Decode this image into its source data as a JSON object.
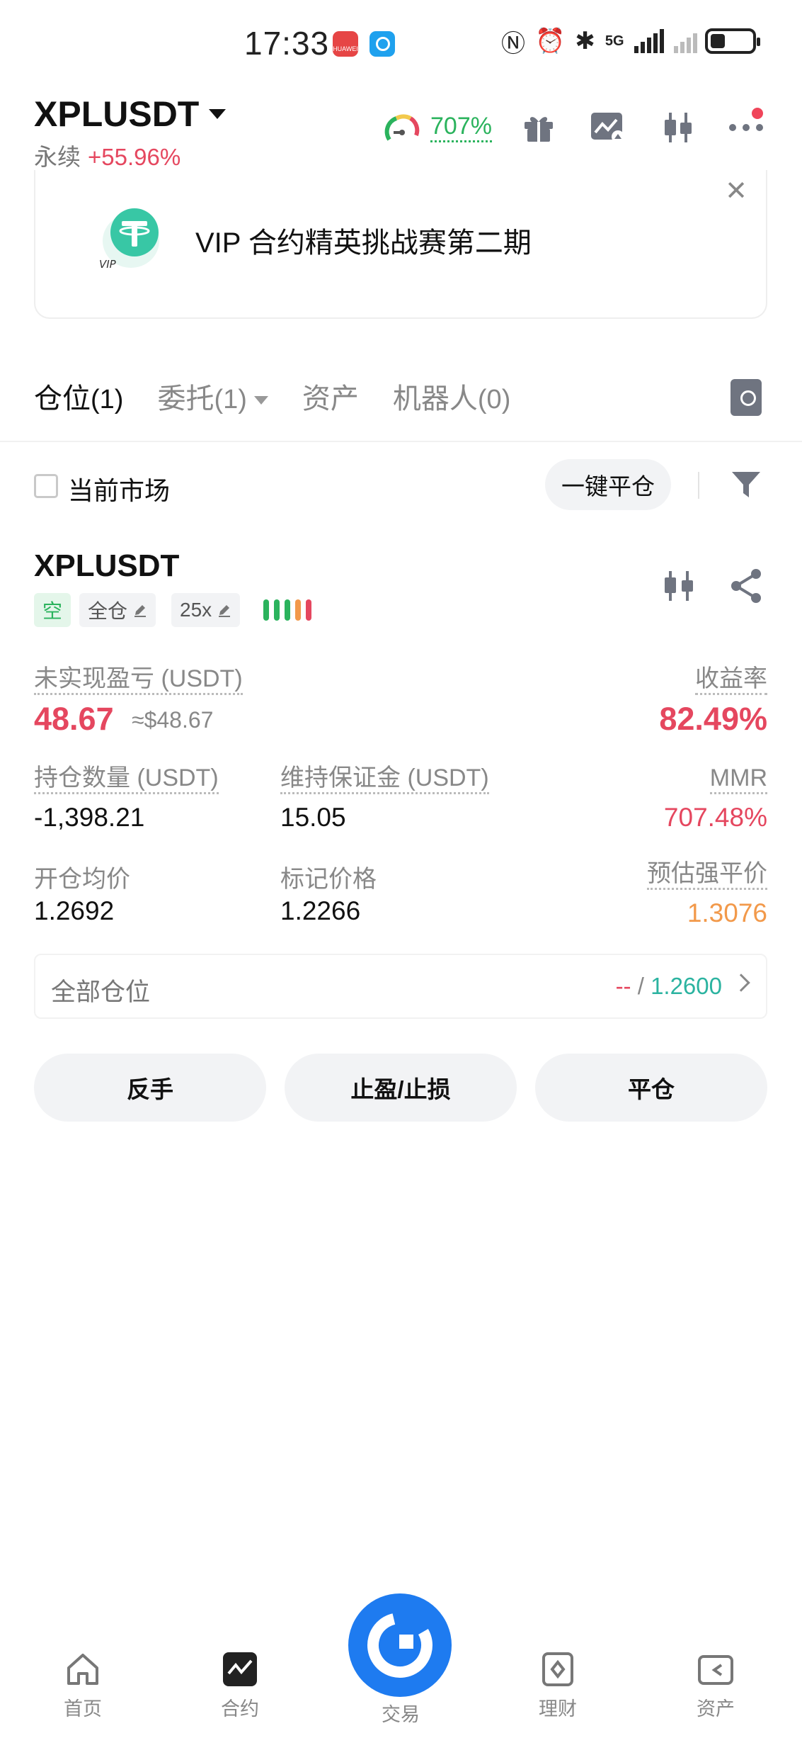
{
  "status_bar": {
    "time": "17:33",
    "app1_label": "HUAWEI",
    "network": "5G"
  },
  "header": {
    "symbol": "XPLUSDT",
    "contract_type": "永续",
    "change": "+55.96%",
    "risk_value": "707%"
  },
  "banner": {
    "text": "VIP 合约精英挑战赛第二期",
    "logo_text": "VIP"
  },
  "tabs": [
    {
      "label": "仓位",
      "count": "(1)",
      "active": true
    },
    {
      "label": "委托",
      "count": "(1)",
      "active": false
    },
    {
      "label": "资产",
      "count": "",
      "active": false
    },
    {
      "label": "机器人",
      "count": "(0)",
      "active": false
    }
  ],
  "filter": {
    "current_market_label": "当前市场",
    "current_market_checked": false,
    "close_all_label": "一键平仓"
  },
  "position": {
    "symbol": "XPLUSDT",
    "side_tag": "空",
    "margin_mode": "全仓",
    "leverage": "25x",
    "risk_bars": 5,
    "unrealized_pnl_label": "未实现盈亏 (USDT)",
    "unrealized_pnl": "48.67",
    "unrealized_pnl_usd": "≈$48.67",
    "roe_label": "收益率",
    "roe": "82.49%",
    "size_label": "持仓数量 (USDT)",
    "size": "-1,398.21",
    "maint_margin_label": "维持保证金 (USDT)",
    "maint_margin": "15.05",
    "mmr_label": "MMR",
    "mmr": "707.48%",
    "entry_label": "开仓均价",
    "entry": "1.2692",
    "mark_label": "标记价格",
    "mark": "1.2266",
    "liq_label": "预估强平价",
    "liq": "1.3076"
  },
  "all_positions": {
    "label": "全部仓位",
    "tp_value": "--",
    "separator": " / ",
    "sl_value": "1.2600"
  },
  "actions": {
    "reverse": "反手",
    "tpsl": "止盈/止损",
    "close": "平仓"
  },
  "bottom_nav": {
    "home": "首页",
    "futures": "合约",
    "trade": "交易",
    "finance": "理财",
    "assets": "资产"
  },
  "colors": {
    "red": "#e5475f",
    "green": "#2bb35d",
    "orange": "#f2994a",
    "blue": "#1e7bf0"
  }
}
